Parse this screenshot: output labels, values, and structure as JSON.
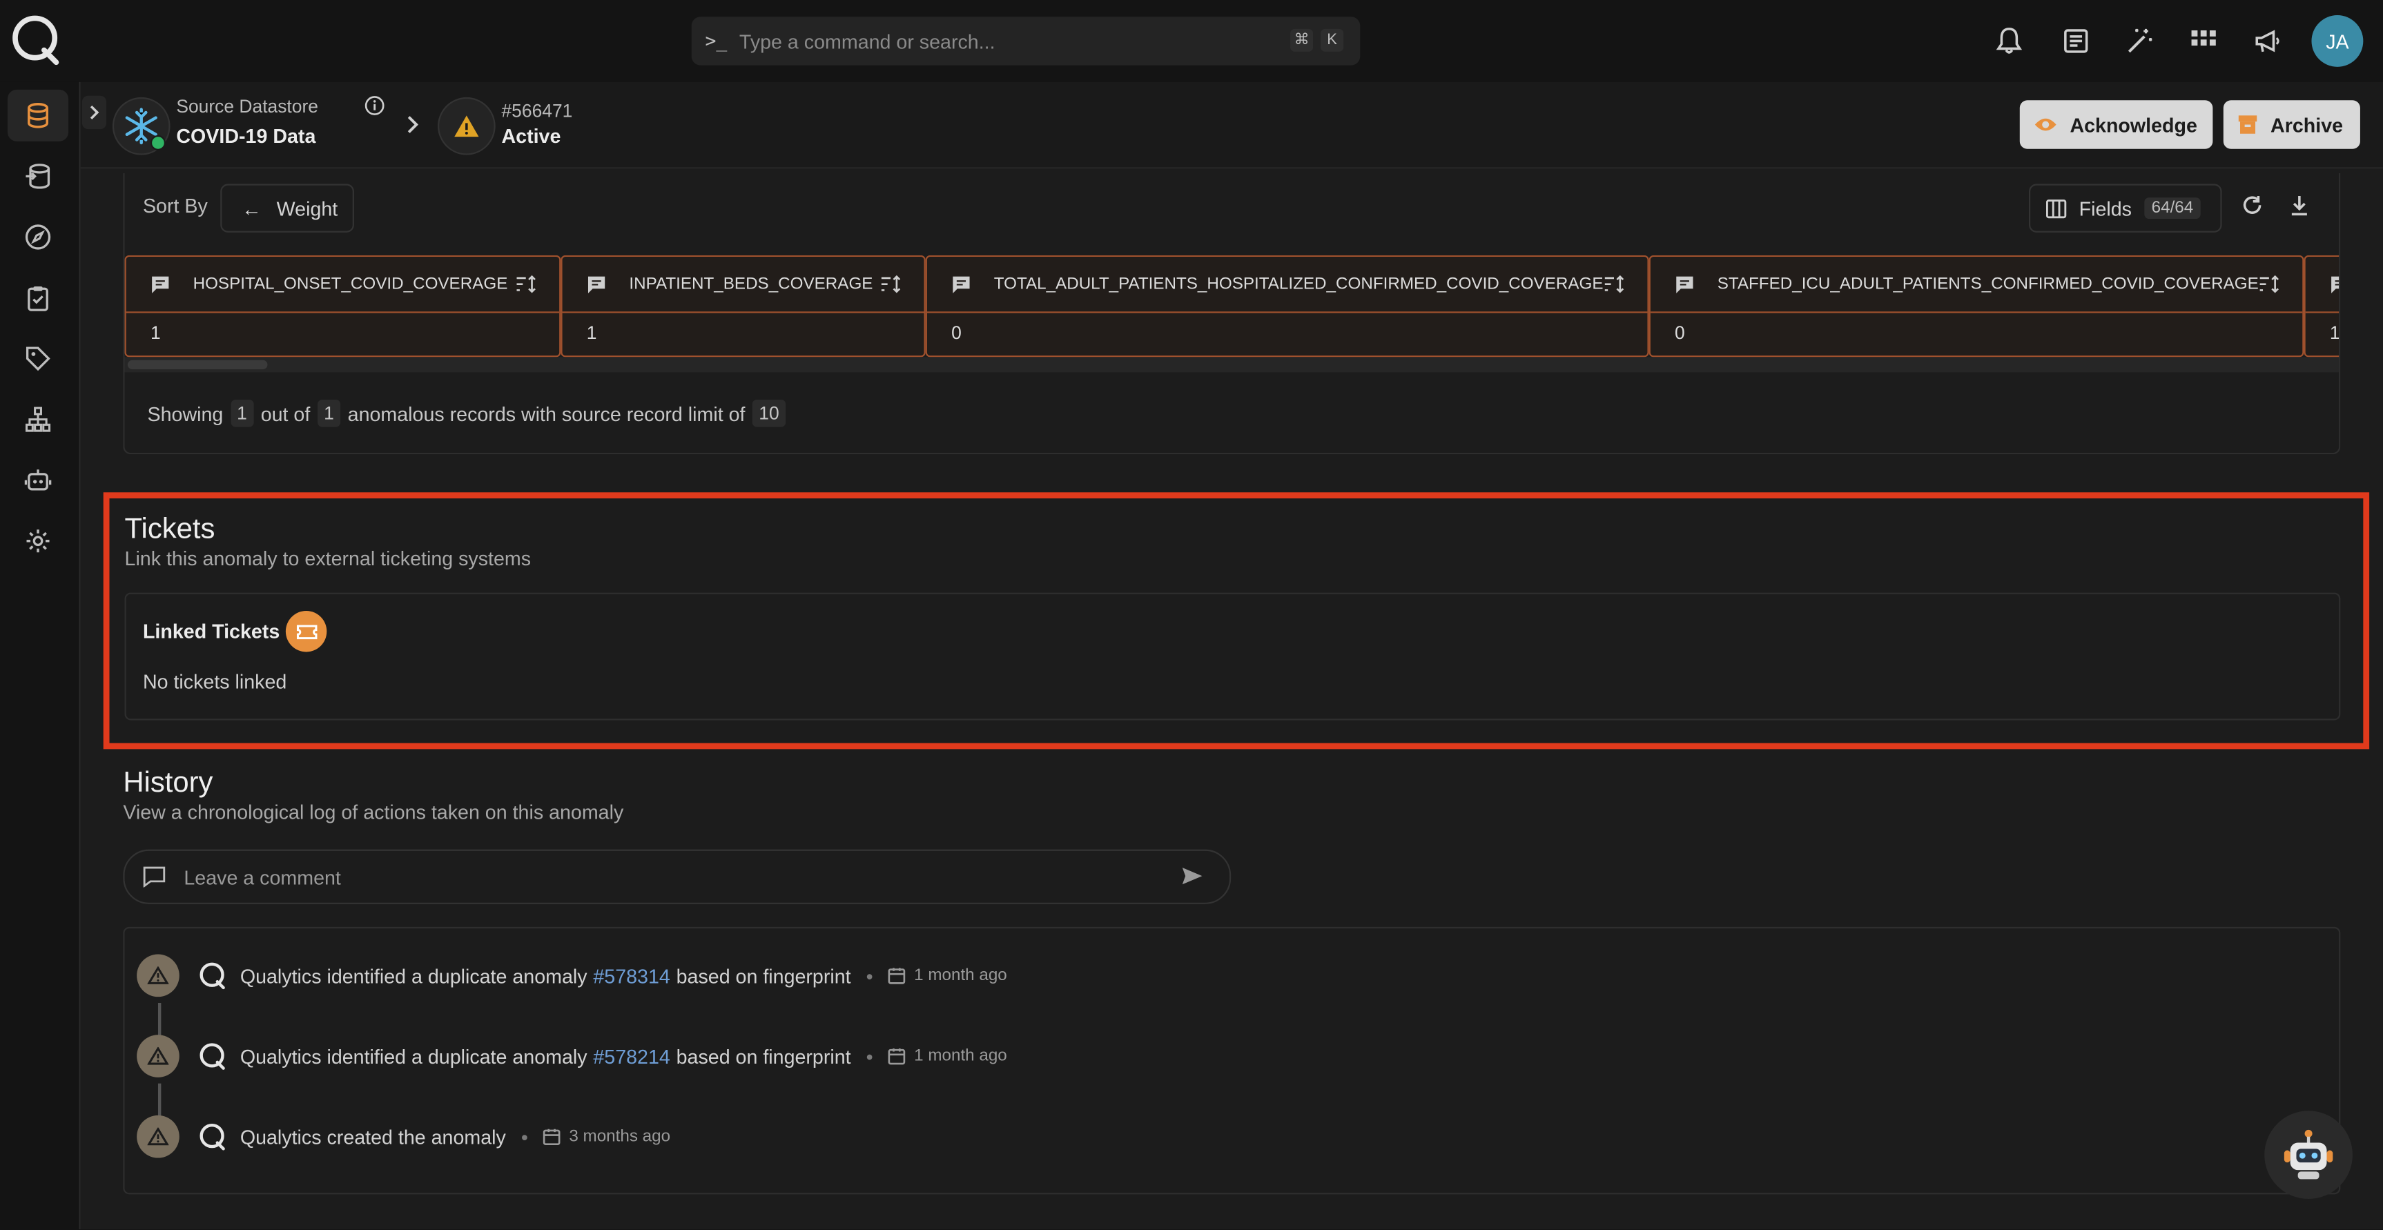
{
  "topbar": {
    "command_placeholder": "Type a command or search...",
    "shortcut_keys": [
      "⌘",
      "K"
    ],
    "avatar_initials": "JA",
    "icons": [
      "bell-icon",
      "notes-icon",
      "magic-wand-icon",
      "apps-grid-icon",
      "megaphone-icon"
    ]
  },
  "sidebar": {
    "items": [
      "datastores",
      "pipeline",
      "explore",
      "checks",
      "tags",
      "flows",
      "agents",
      "settings"
    ],
    "active": "datastores"
  },
  "header": {
    "datastore_label": "Source Datastore",
    "datastore_name": "COVID-19 Data",
    "anomaly_id": "#566471",
    "anomaly_status": "Active",
    "acknowledge_label": "Acknowledge",
    "archive_label": "Archive"
  },
  "records": {
    "sort_by_label": "Sort By",
    "sort_value": "Weight",
    "fields_label": "Fields",
    "fields_count": "64/64",
    "columns": [
      {
        "name": "HOSPITAL_ONSET_COVID_COVERAGE",
        "value": "1"
      },
      {
        "name": "INPATIENT_BEDS_COVERAGE",
        "value": "1"
      },
      {
        "name": "TOTAL_ADULT_PATIENTS_HOSPITALIZED_CONFIRMED_COVID_COVERAGE",
        "value": "0"
      },
      {
        "name": "STAFFED_ICU_ADULT_PATIENTS_CONFIRMED_COVID_COVERAGE",
        "value": "0"
      },
      {
        "name": "",
        "value": "1"
      }
    ],
    "showing": {
      "prefix": "Showing",
      "shown": "1",
      "out_of": "out of",
      "total": "1",
      "suffix": "anomalous records with source record limit of",
      "limit": "10"
    }
  },
  "tickets": {
    "title": "Tickets",
    "subtitle": "Link this anomaly to external ticketing systems",
    "linked_label": "Linked Tickets",
    "empty_text": "No tickets linked"
  },
  "history": {
    "title": "History",
    "subtitle": "View a chronological log of actions taken on this anomaly",
    "comment_placeholder": "Leave a comment",
    "events": [
      {
        "pre": "Qualytics identified a duplicate anomaly",
        "link": "#578314",
        "post": "based on fingerprint",
        "time": "1 month ago"
      },
      {
        "pre": "Qualytics identified a duplicate anomaly",
        "link": "#578214",
        "post": "based on fingerprint",
        "time": "1 month ago"
      },
      {
        "pre": "Qualytics created the anomaly",
        "link": "",
        "post": "",
        "time": "3 months ago"
      }
    ]
  },
  "colors": {
    "accent": "#e8913e",
    "highlight": "#e13a1c",
    "link": "#6f9ed6",
    "background": "#1c1c1c"
  }
}
